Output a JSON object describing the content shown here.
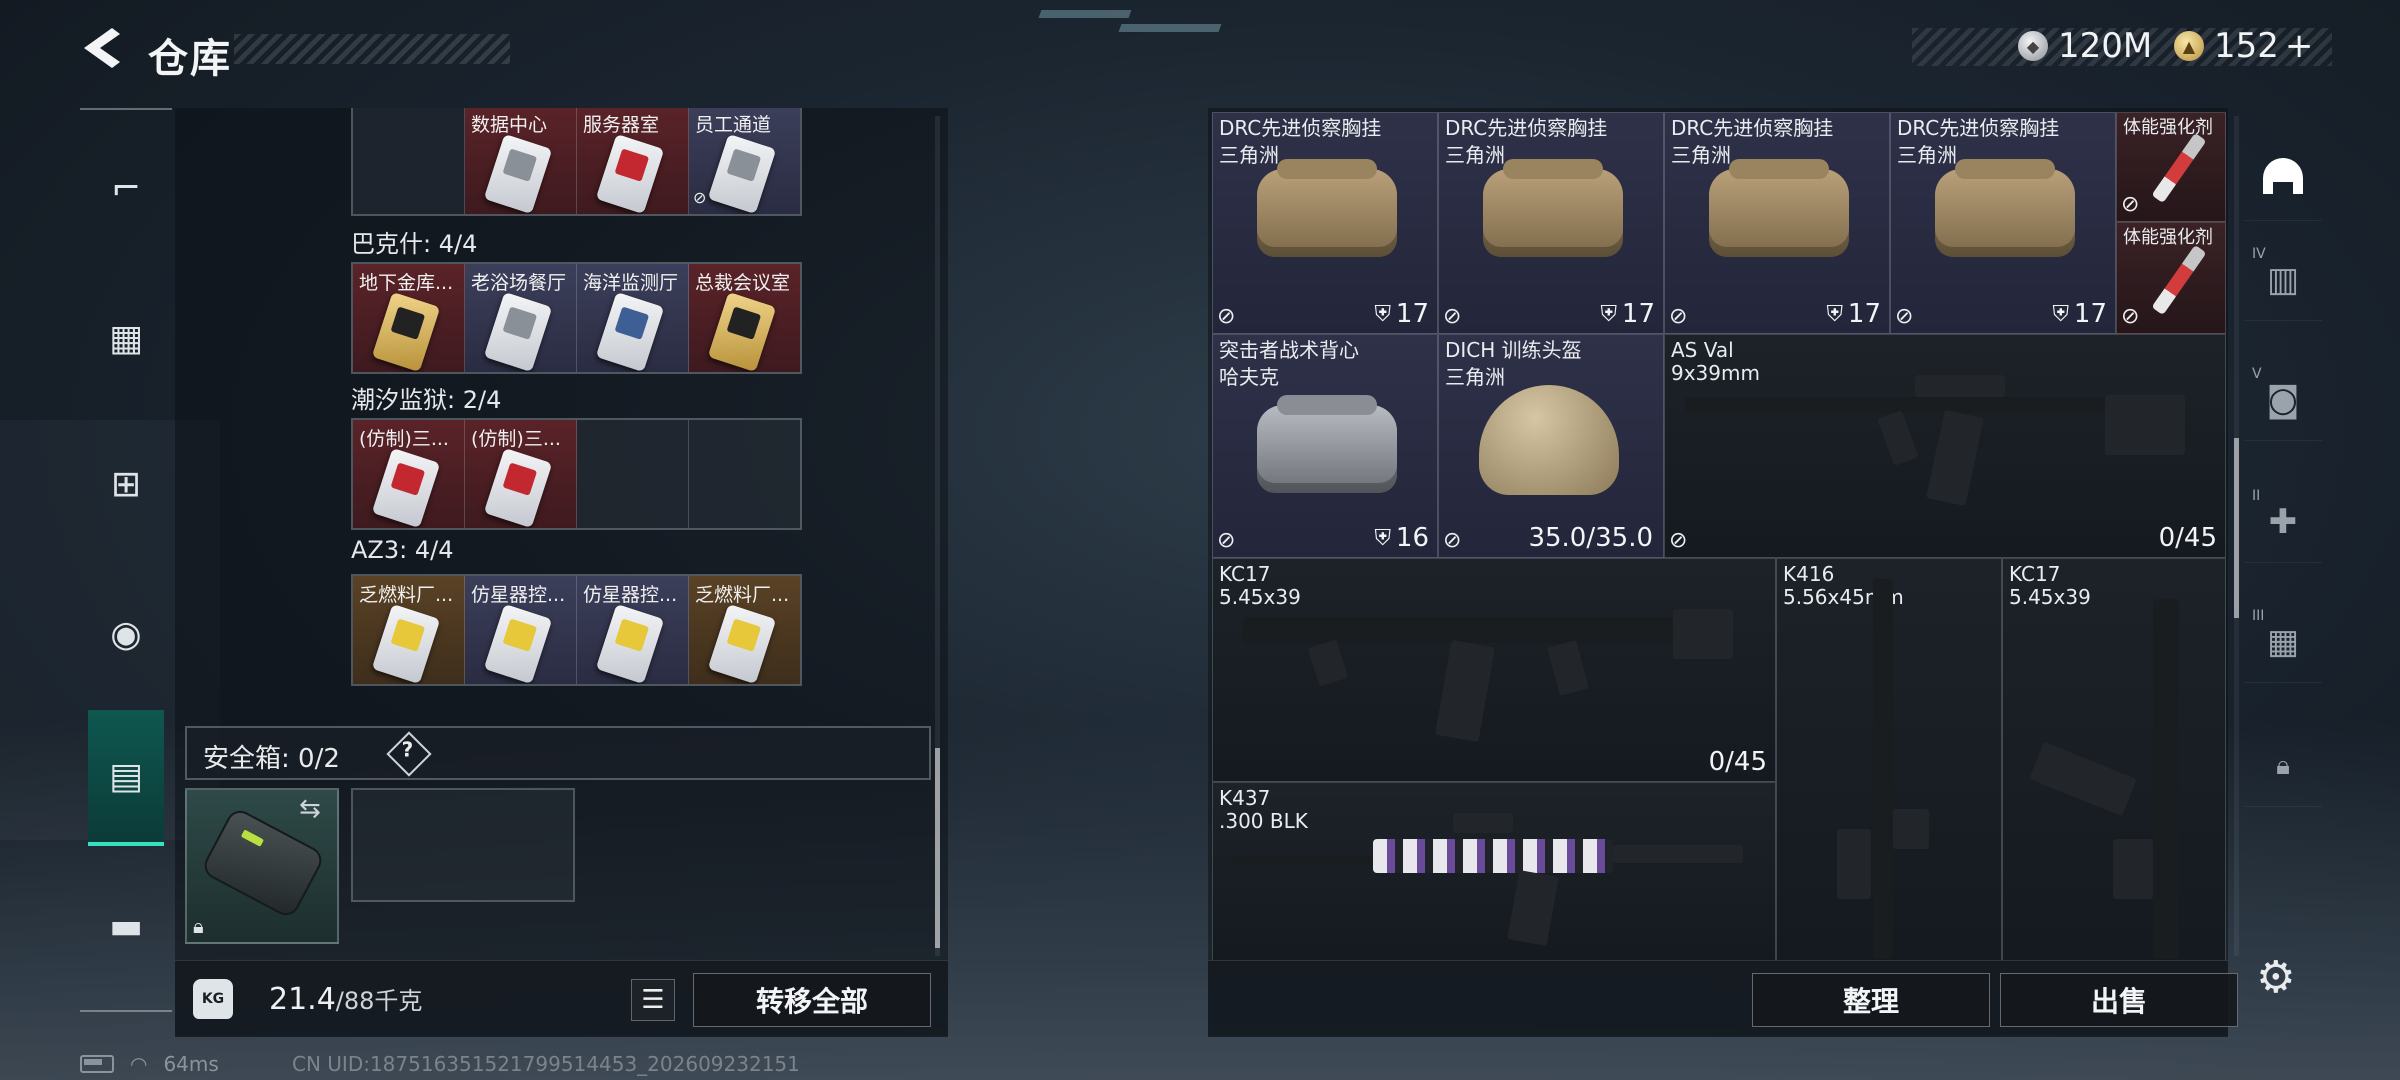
{
  "header": {
    "title": "仓库",
    "silver": "120M",
    "gold": "152",
    "gold_plus": "+"
  },
  "side_nav": [
    "gun-icon",
    "vest-icon",
    "backpack-icon",
    "bag-icon",
    "case-icon",
    "toolbox-icon"
  ],
  "stash": {
    "top_row": {
      "labels": [
        "",
        "数据中心",
        "服务器室",
        "员工通道"
      ]
    },
    "sections": [
      {
        "title": "巴克什: 4/4",
        "items": [
          "地下金库...",
          "老浴场餐厅",
          "海洋监测厅",
          "总裁会议室"
        ]
      },
      {
        "title": "潮汐监狱: 2/4",
        "items": [
          "(仿制)三...",
          "(仿制)三..."
        ]
      },
      {
        "title": "AZ3: 4/4",
        "items": [
          "乏燃料厂...",
          "仿星器控...",
          "仿星器控...",
          "乏燃料厂..."
        ]
      }
    ],
    "safe": {
      "title": "安全箱: 0/2",
      "help": "?"
    },
    "weight": {
      "current": "21.4",
      "max": "/88千克",
      "kg_icon": "KG"
    },
    "transfer_label": "转移全部"
  },
  "inventory": {
    "row1": [
      {
        "name": "DRC先进侦察胸挂",
        "sub": "三角洲",
        "count": "17"
      },
      {
        "name": "DRC先进侦察胸挂",
        "sub": "三角洲",
        "count": "17"
      },
      {
        "name": "DRC先进侦察胸挂",
        "sub": "三角洲",
        "count": "17"
      },
      {
        "name": "DRC先进侦察胸挂",
        "sub": "三角洲",
        "count": "17"
      }
    ],
    "syringes": [
      "体能强化剂",
      "体能强化剂"
    ],
    "vest": {
      "name": "突击者战术背心",
      "sub": "哈夫克",
      "count": "16"
    },
    "helmet": {
      "name": "DICH 训练头盔",
      "sub": "三角洲",
      "durability": "35.0/35.0"
    },
    "asval": {
      "name": "AS Val",
      "sub": "9x39mm",
      "ammo": "0/45"
    },
    "kc17a": {
      "name": "KC17",
      "sub": "5.45x39",
      "ammo": "0/45"
    },
    "k416": {
      "name": "K416",
      "sub": "5.56x45mm"
    },
    "kc17b": {
      "name": "KC17",
      "sub": "5.45x39"
    },
    "k437": {
      "name": "K437",
      "sub": ".300 BLK"
    },
    "sort_label": "整理",
    "sell_label": "出售"
  },
  "categories": [
    {
      "roman": "",
      "icon": "helmet-category-icon"
    },
    {
      "roman": "IV",
      "icon": "folder-category-icon"
    },
    {
      "roman": "V",
      "icon": "camera-category-icon"
    },
    {
      "roman": "II",
      "icon": "medkit-category-icon"
    },
    {
      "roman": "III",
      "icon": "crate-category-icon"
    },
    {
      "roman": "",
      "icon": "lock-icon"
    }
  ],
  "status": {
    "latency": "64ms",
    "uid": "CN UID:18751635152179951445​3_202609232151"
  }
}
